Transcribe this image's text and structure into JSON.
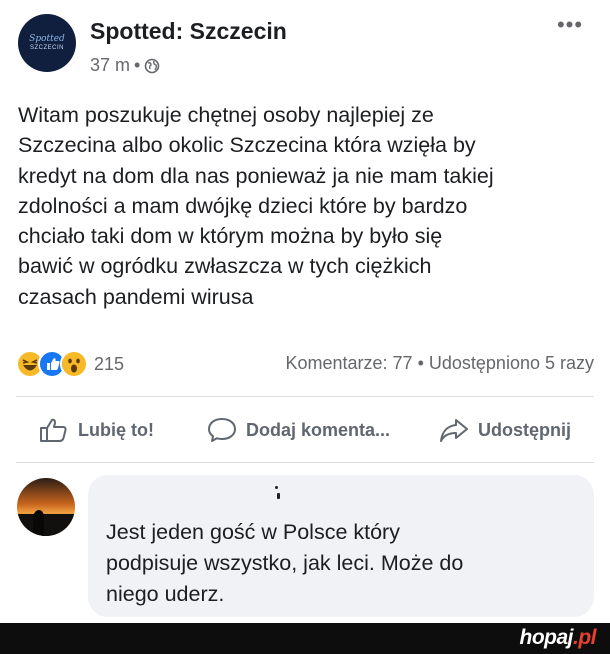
{
  "post": {
    "page_name": "Spotted: Szczecin",
    "avatar_text_1": "Spotted",
    "avatar_text_2": "SZCZECIN",
    "time": "37 m",
    "separator": "•",
    "more_label": "•••",
    "text_lines": [
      "Witam poszukuje chętnej osoby najlepiej ze",
      "Szczecina albo okolic Szczecina która wzięła by",
      "kredyt na dom dla nas ponieważ ja nie mam takiej",
      "zdolności a mam dwójkę dzieci które by bardzo",
      "chciało taki dom w którym można by było się",
      "bawić w ogródku zwłaszcza w tych ciężkich",
      "czasach pandemi wirusa"
    ]
  },
  "stats": {
    "reactions": [
      "haha",
      "like",
      "wow"
    ],
    "reaction_count": "215",
    "comments": "Komentarze: 77",
    "shares_separator": "•",
    "shares": "Udostępniono 5 razy"
  },
  "actions": {
    "like": "Lubię to!",
    "comment": "Dodaj komenta...",
    "share": "Udostępnij"
  },
  "comment": {
    "text_lines": [
      "Jest jeden gość w Polsce który",
      "podpisuje wszystko, jak leci. Może do",
      "niego uderz."
    ]
  },
  "watermark": {
    "name": "hopaj",
    "tld": ".pl"
  },
  "colors": {
    "text": "#1c1e21",
    "secondary": "#65676b",
    "action": "#606770",
    "bubble": "#f0f2f5",
    "like_blue": "#1877f2",
    "reaction_yellow": "#f7b928",
    "watermark_accent": "#e8402a"
  }
}
